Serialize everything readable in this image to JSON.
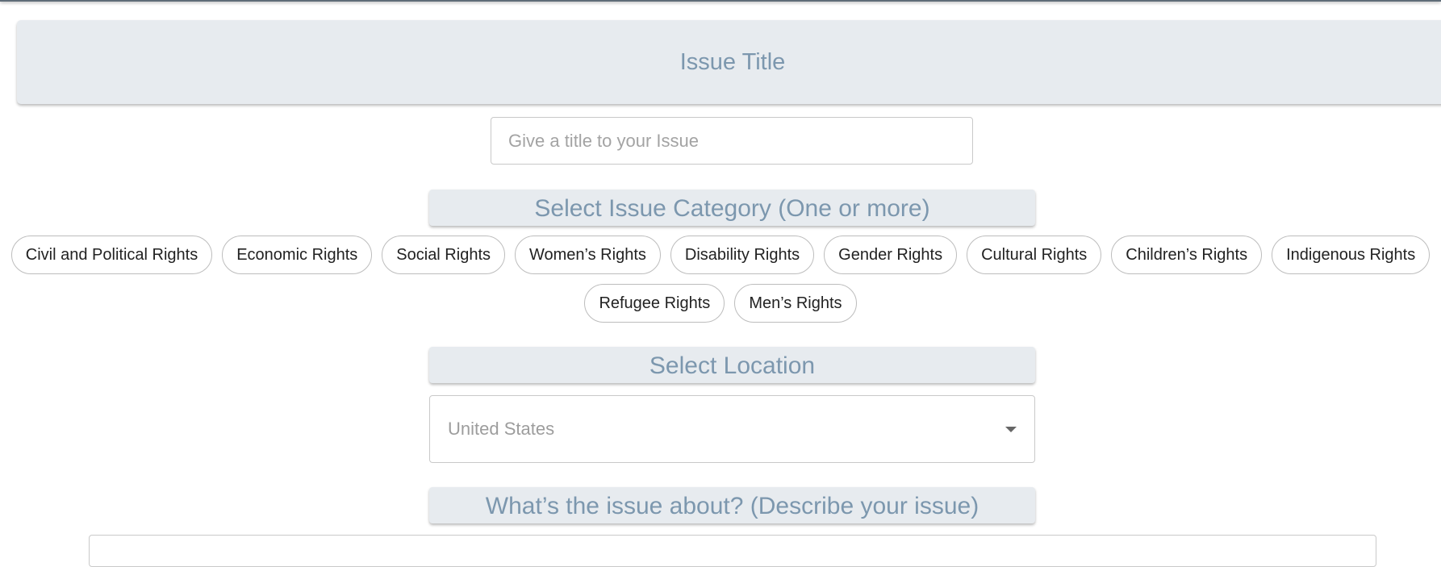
{
  "issue_title": {
    "banner_label": "Issue Title",
    "input_placeholder": "Give a title to your Issue",
    "input_value": ""
  },
  "category": {
    "header": "Select Issue Category (One or more)",
    "chips_row1": [
      "Civil and Political Rights",
      "Economic Rights",
      "Social Rights",
      "Women’s Rights",
      "Disability Rights",
      "Gender Rights",
      "Cultural Rights",
      "Children’s Rights",
      "Indigenous Rights"
    ],
    "chips_row2": [
      "Refugee Rights",
      "Men’s Rights"
    ]
  },
  "location": {
    "header": "Select Location",
    "selected_value": "United States",
    "caret_icon": "chevron-down-icon"
  },
  "description": {
    "header": "What’s the issue about? (Describe your issue)",
    "textarea_value": ""
  },
  "colors": {
    "header_bg": "#e7ebef",
    "header_text": "#7c97ae",
    "chip_border": "#bdbdbd"
  }
}
